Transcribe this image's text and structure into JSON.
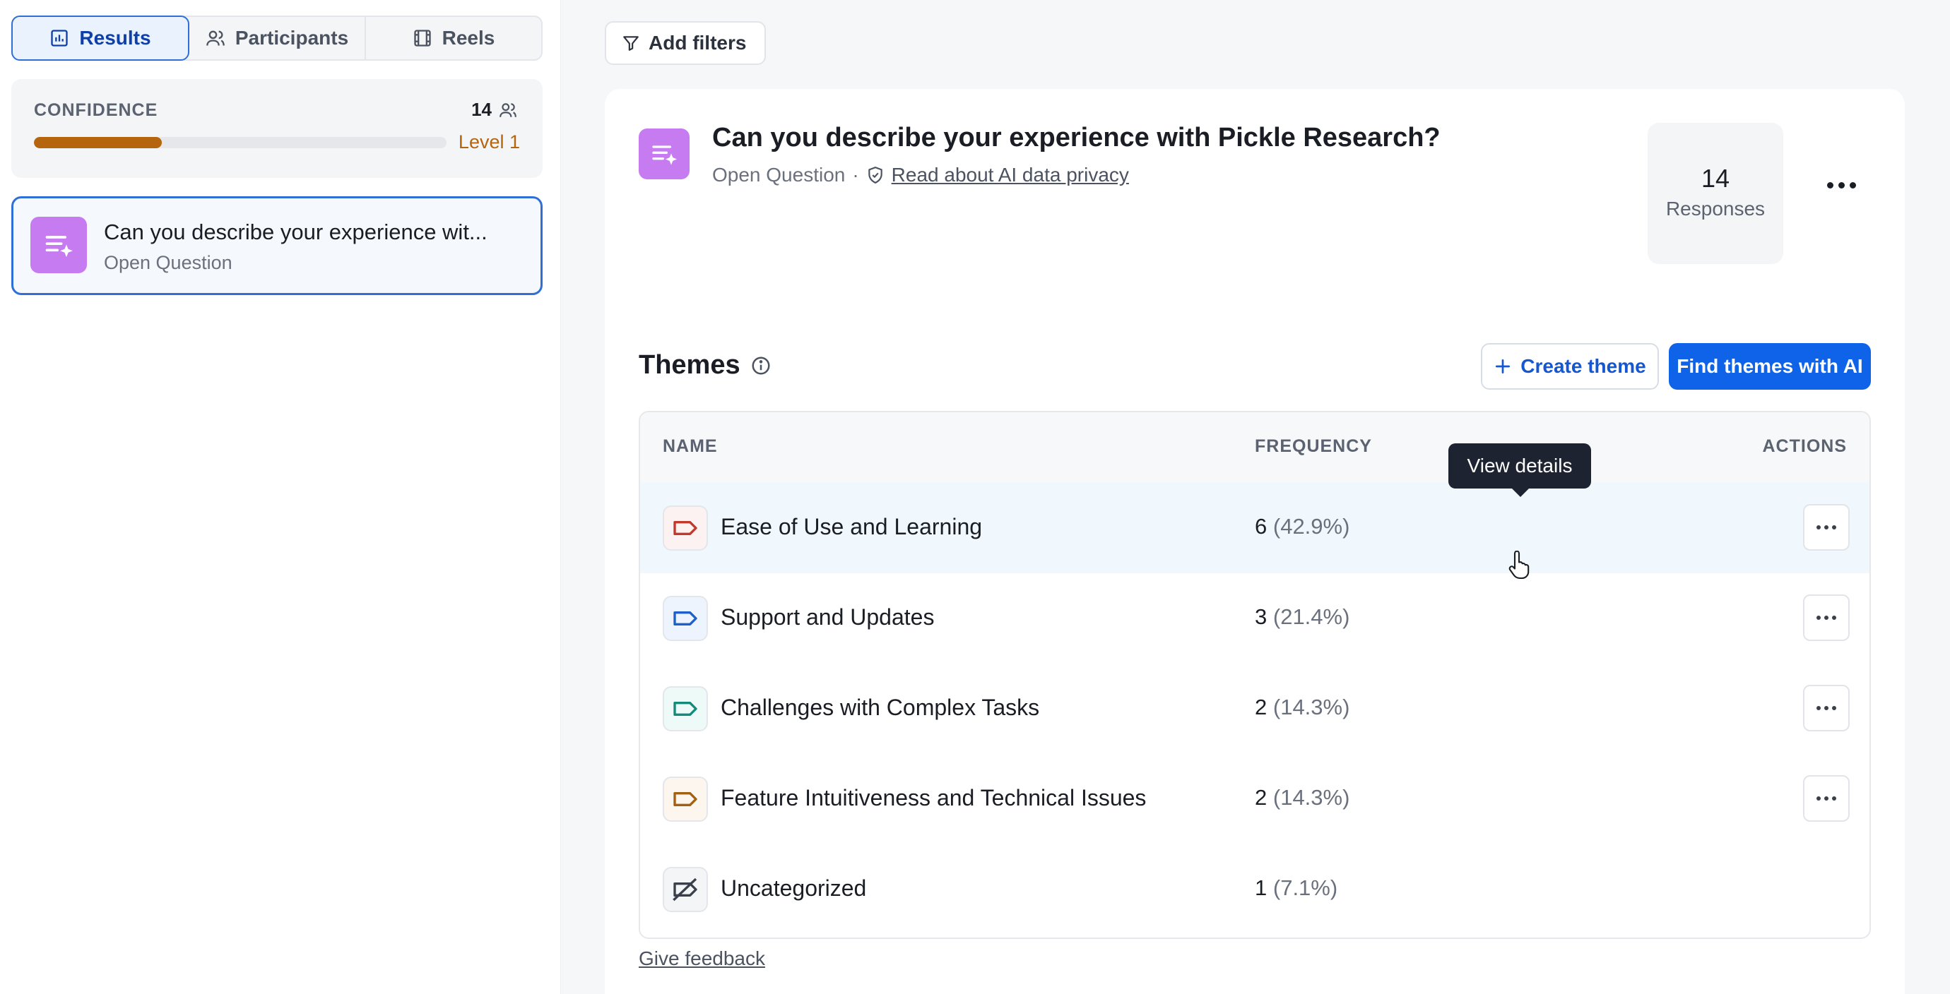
{
  "view_tabs": [
    {
      "label": "Results",
      "icon": "bar-chart-icon",
      "active": true
    },
    {
      "label": "Participants",
      "icon": "users-icon",
      "active": false
    },
    {
      "label": "Reels",
      "icon": "film-icon",
      "active": false
    }
  ],
  "confidence": {
    "label": "CONFIDENCE",
    "count": "14",
    "count_icon": "users-icon",
    "level": "Level 1",
    "progress_fraction": 0.31,
    "bar_color": "#b5650d"
  },
  "question_card": {
    "title": "Can you describe your experience wit...",
    "type": "Open Question",
    "icon": "ai-text-icon",
    "icon_color": "#c67cf0"
  },
  "toolbar": {
    "add_filters_label": "Add filters",
    "add_filters_icon": "filter-icon"
  },
  "question": {
    "title": "Can you describe your experience with Pickle Research?",
    "type": "Open Question",
    "separator": "·",
    "privacy_link": "Read about AI data privacy",
    "privacy_icon": "shield-check-icon",
    "responses_count": "14",
    "responses_label": "Responses",
    "more_icon": "more-horizontal-icon"
  },
  "themes": {
    "heading": "Themes",
    "info_icon": "info-icon",
    "create_label": "Create theme",
    "create_icon": "plus-icon",
    "find_ai_label": "Find themes with AI",
    "accent_color": "#0f63e8",
    "columns": {
      "name": "NAME",
      "frequency": "FREQUENCY",
      "actions": "ACTIONS"
    },
    "rows": [
      {
        "name": "Ease of Use and Learning",
        "count": "6",
        "pct": "(42.9%)",
        "icon": "tag-icon",
        "color": "#c0392b",
        "bg": "#fdf2f2",
        "hover": true,
        "has_action": true
      },
      {
        "name": "Support and Updates",
        "count": "3",
        "pct": "(21.4%)",
        "icon": "tag-icon",
        "color": "#1f5fc9",
        "bg": "#eef4fd",
        "hover": false,
        "has_action": true
      },
      {
        "name": "Challenges with Complex Tasks",
        "count": "2",
        "pct": "(14.3%)",
        "icon": "tag-icon",
        "color": "#138a7a",
        "bg": "#eefaf8",
        "hover": false,
        "has_action": true
      },
      {
        "name": "Feature Intuitiveness and Technical Issues",
        "count": "2",
        "pct": "(14.3%)",
        "icon": "tag-icon",
        "color": "#a35f12",
        "bg": "#fdf6ee",
        "hover": false,
        "has_action": true
      },
      {
        "name": "Uncategorized",
        "count": "1",
        "pct": "(7.1%)",
        "icon": "tag-off-icon",
        "color": "#3a404b",
        "bg": "#f4f5f7",
        "hover": false,
        "has_action": false
      }
    ]
  },
  "tooltip": {
    "label": "View details"
  },
  "feedback": {
    "label": "Give feedback"
  }
}
